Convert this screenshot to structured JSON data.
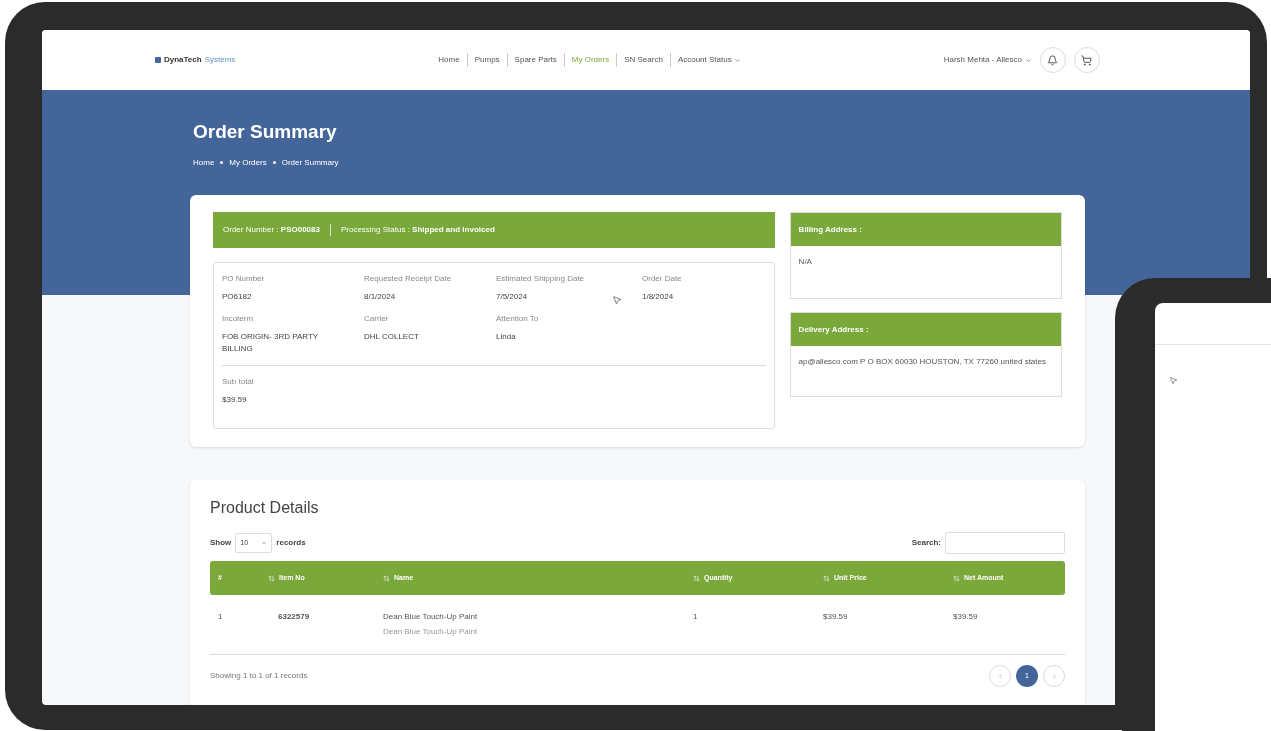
{
  "nav": {
    "logo": {
      "brand": "DynaTech",
      "tagline": "Systems"
    },
    "items": [
      {
        "label": "Home",
        "selected": false,
        "dropdown": false
      },
      {
        "label": "Pumps",
        "selected": false,
        "dropdown": false
      },
      {
        "label": "Spare Parts",
        "selected": false,
        "dropdown": false
      },
      {
        "label": "My Orders",
        "selected": true,
        "dropdown": false
      },
      {
        "label": "SN Search",
        "selected": false,
        "dropdown": false
      },
      {
        "label": "Account Status",
        "selected": false,
        "dropdown": true
      }
    ],
    "user": "Harsh Mehta - Allesco"
  },
  "header": {
    "title": "Order Summary",
    "breadcrumb": [
      "Home",
      "My Orders",
      "Order Summary"
    ]
  },
  "order": {
    "number": "Order Number : **PSO00083**",
    "status": "Processing Status : **Shipped and Invoiced**",
    "fields": [
      {
        "label": "PO Number",
        "value": "PO6182"
      },
      {
        "label": "Requested Receipt Date",
        "value": "8/1/2024"
      },
      {
        "label": "Estimated Shipping Date",
        "value": "7/5/2024"
      },
      {
        "label": "Order Date",
        "value": "1/8/2024"
      },
      {
        "label": "Incoterm",
        "value": "FOB ORIGIN- 3RD PARTY BILLING"
      },
      {
        "label": "Carrier",
        "value": "DHL COLLECT"
      },
      {
        "label": "Attention To",
        "value": "Linda"
      }
    ],
    "subtotal": {
      "label": "Sub total",
      "value": "$39.59"
    }
  },
  "addresses": [
    {
      "title": "Billing Address :",
      "body": "N/A"
    },
    {
      "title": "Delivery Address :",
      "body": "ap@allesco.com P O BOX 60030 HOUSTON, TX 77260 united states"
    }
  ],
  "products": {
    "title": "Product Details",
    "show_label": "Show",
    "page_size": "10",
    "records_label": "records",
    "search_label": "Search:",
    "columns": [
      "#",
      "Item No",
      "Name",
      "Quantity",
      "Unit Price",
      "Net Amount"
    ],
    "rows": [
      {
        "index": "1",
        "item_no": "6322579",
        "name": "Dean Blue Touch-Up Paint",
        "description": "Dean Blue Touch-Up Paint",
        "quantity": "1",
        "unit_price": "$39.59",
        "net_amount": "$39.59"
      }
    ],
    "info": "Showing 1 to 1 of 1 records",
    "pages": [
      {
        "label": "1",
        "selected": true
      }
    ]
  }
}
